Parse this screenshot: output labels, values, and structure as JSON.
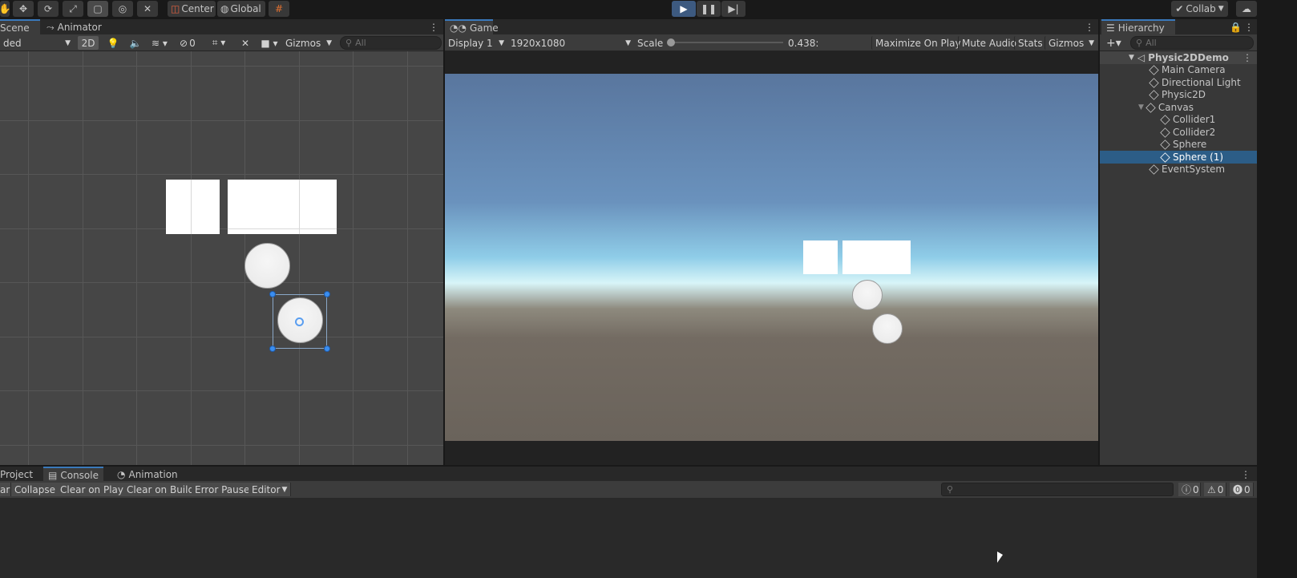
{
  "toolbar": {
    "pivot_label": "Center",
    "space_label": "Global",
    "collab_label": "Collab"
  },
  "scene": {
    "tabs": [
      {
        "label": "Scene"
      },
      {
        "label": "Animator"
      }
    ],
    "shading_mode": "ded",
    "mode_2d": "2D",
    "hidden_count": "0",
    "gizmos_label": "Gizmos",
    "search_placeholder": "All"
  },
  "game": {
    "tab_label": "Game",
    "display": "Display 1",
    "resolution": "1920x1080",
    "scale_label": "Scale",
    "scale_value": "0.438:",
    "scale_fraction": 0.0,
    "maximize_label": "Maximize On Play",
    "mute_label": "Mute Audio",
    "stats_label": "Stats",
    "gizmos_label": "Gizmos"
  },
  "hierarchy": {
    "tab_label": "Hierarchy",
    "search_placeholder": "All",
    "scene_name": "Physic2DDemo",
    "items": [
      {
        "label": "Main Camera"
      },
      {
        "label": "Directional Light"
      },
      {
        "label": "Physic2D"
      },
      {
        "label": "Canvas"
      },
      {
        "label": "Collider1"
      },
      {
        "label": "Collider2"
      },
      {
        "label": "Sphere"
      },
      {
        "label": "Sphere (1)"
      },
      {
        "label": "EventSystem"
      }
    ]
  },
  "console": {
    "tabs": [
      {
        "label": "Project"
      },
      {
        "label": "Console"
      },
      {
        "label": "Animation"
      }
    ],
    "clear_label": "ar",
    "collapse_label": "Collapse",
    "clear_on_play_label": "Clear on Play",
    "clear_on_build_label": "Clear on Build",
    "error_pause_label": "Error Pause",
    "editor_label": "Editor",
    "info_count": "0",
    "warning_count": "0",
    "error_count": "0"
  },
  "colors": {
    "selection": "#2c5d87",
    "accent": "#3a79bb",
    "handle": "#3a8ef0"
  }
}
